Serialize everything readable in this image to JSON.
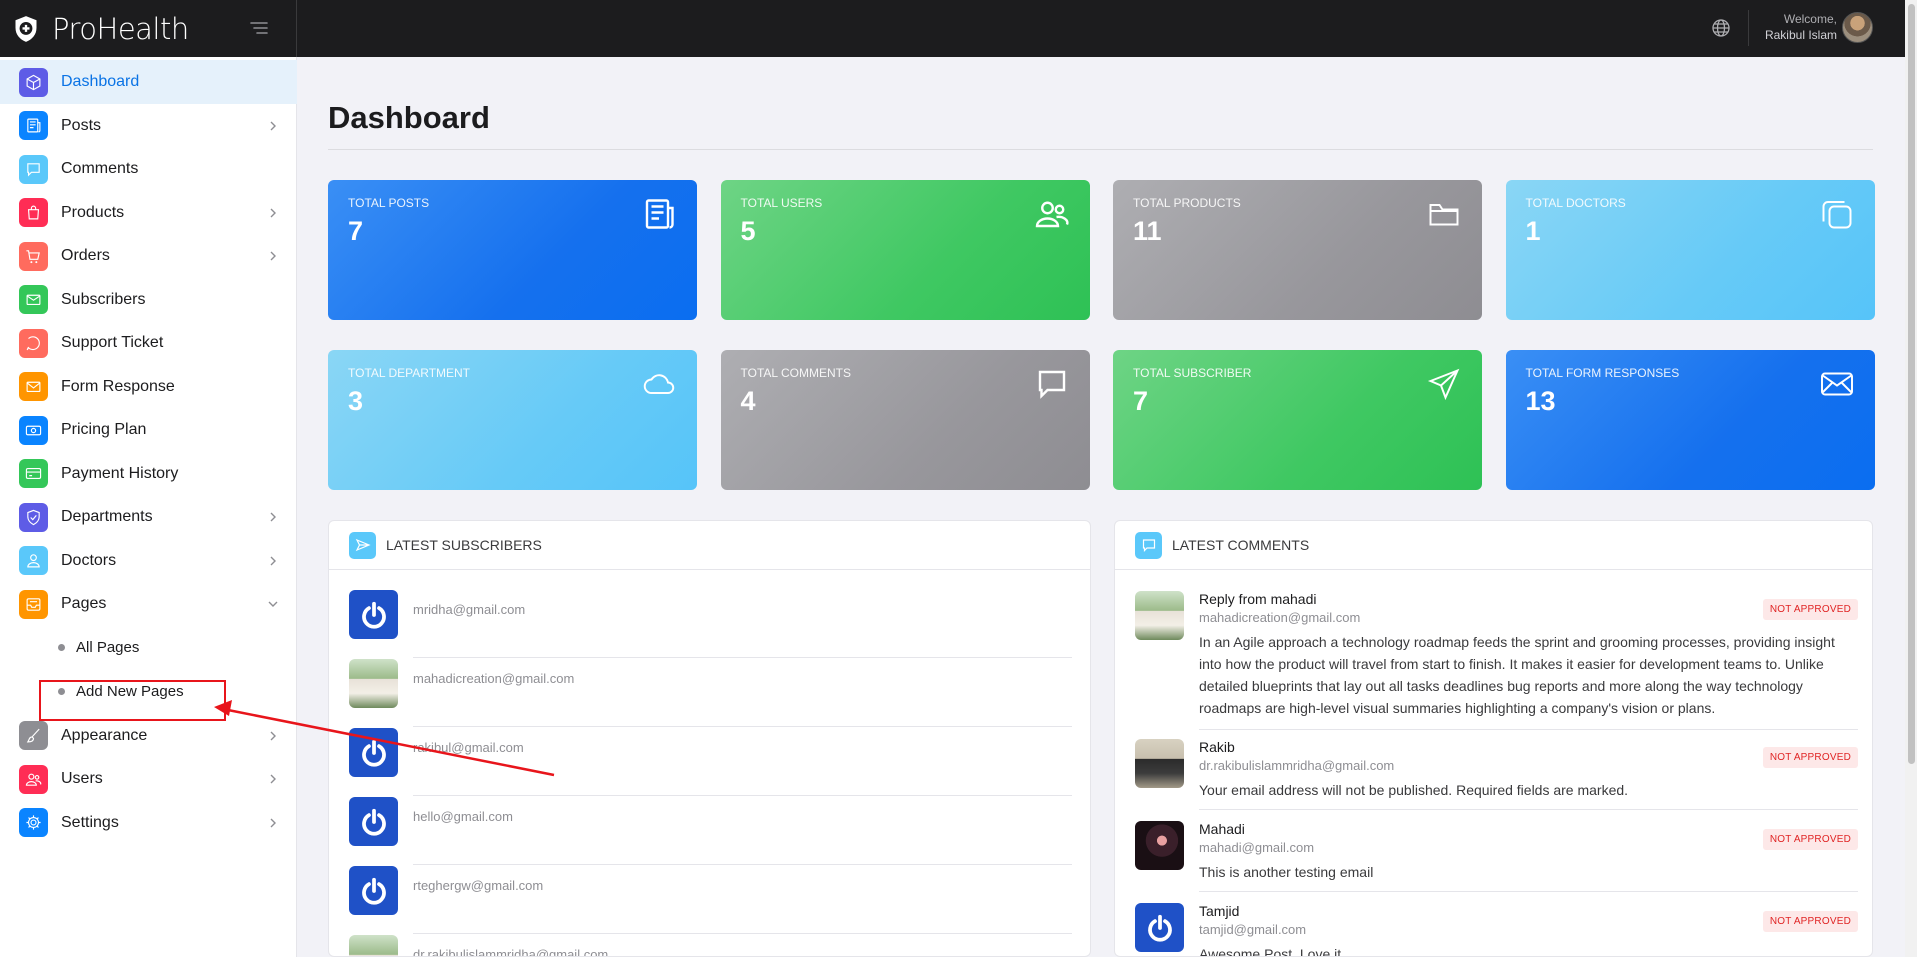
{
  "brand": {
    "name": "ProHealth"
  },
  "topbar": {
    "welcome": "Welcome,",
    "user_name": "Rakibul Islam"
  },
  "sidebar": {
    "items": [
      {
        "label": "Dashboard",
        "icon": "cube-icon",
        "color": "#5e5ce6",
        "active": true,
        "chevron": false
      },
      {
        "label": "Posts",
        "icon": "newspaper-icon",
        "color": "#0a84ff",
        "chevron": true
      },
      {
        "label": "Comments",
        "icon": "chat-bubble-icon",
        "color": "#5ac8fa",
        "chevron": false
      },
      {
        "label": "Products",
        "icon": "shopping-bag-icon",
        "color": "#ff2d55",
        "chevron": true
      },
      {
        "label": "Orders",
        "icon": "cart-icon",
        "color": "#ff6b5e",
        "chevron": true
      },
      {
        "label": "Subscribers",
        "icon": "envelope-icon",
        "color": "#34c759",
        "chevron": false
      },
      {
        "label": "Support Ticket",
        "icon": "lifebuoy-icon",
        "color": "#ff6b5e",
        "chevron": false
      },
      {
        "label": "Form Response",
        "icon": "mail-icon",
        "color": "#ff9500",
        "chevron": false
      },
      {
        "label": "Pricing Plan",
        "icon": "money-icon",
        "color": "#0a84ff",
        "chevron": false
      },
      {
        "label": "Payment History",
        "icon": "credit-card-icon",
        "color": "#34c759",
        "chevron": false
      },
      {
        "label": "Departments",
        "icon": "shield-icon",
        "color": "#5e5ce6",
        "chevron": true
      },
      {
        "label": "Doctors",
        "icon": "user-icon",
        "color": "#5ac8fa",
        "chevron": true
      },
      {
        "label": "Pages",
        "icon": "inbox-icon",
        "color": "#ff9500",
        "chevron": true,
        "expanded": true
      },
      {
        "label": "Appearance",
        "icon": "brush-icon",
        "color": "#8e8e93",
        "chevron": true
      },
      {
        "label": "Users",
        "icon": "users-icon",
        "color": "#ff2d55",
        "chevron": true
      },
      {
        "label": "Settings",
        "icon": "gear-icon",
        "color": "#0a84ff",
        "chevron": true
      }
    ],
    "pages_sub": [
      {
        "label": "All Pages"
      },
      {
        "label": "Add New Pages"
      }
    ]
  },
  "main": {
    "title": "Dashboard"
  },
  "stats": [
    {
      "label": "TOTAL POSTS",
      "value": "7",
      "icon": "newspaper-icon",
      "gradient": "blue"
    },
    {
      "label": "TOTAL USERS",
      "value": "5",
      "icon": "users-icon",
      "gradient": "green"
    },
    {
      "label": "TOTAL PRODUCTS",
      "value": "11",
      "icon": "folder-icon",
      "gradient": "gray"
    },
    {
      "label": "TOTAL DOCTORS",
      "value": "1",
      "icon": "copy-icon",
      "gradient": "sky"
    },
    {
      "label": "TOTAL DEPARTMENT",
      "value": "3",
      "icon": "cloud-icon",
      "gradient": "sky"
    },
    {
      "label": "TOTAL COMMENTS",
      "value": "4",
      "icon": "chat-bubble-icon",
      "gradient": "gray"
    },
    {
      "label": "TOTAL SUBSCRIBER",
      "value": "7",
      "icon": "paper-plane-icon",
      "gradient": "green"
    },
    {
      "label": "TOTAL FORM RESPONSES",
      "value": "13",
      "icon": "envelope-open-icon",
      "gradient": "blue"
    }
  ],
  "subscribers": {
    "title": "LATEST SUBSCRIBERS",
    "items": [
      {
        "email": "mridha@gmail.com",
        "avatar": "power"
      },
      {
        "email": "mahadicreation@gmail.com",
        "avatar": "photo"
      },
      {
        "email": "rakibul@gmail.com",
        "avatar": "power"
      },
      {
        "email": "hello@gmail.com",
        "avatar": "power"
      },
      {
        "email": "rteghergw@gmail.com",
        "avatar": "power"
      },
      {
        "email": "dr.rakibulislammridha@gmail.com",
        "avatar": "photo"
      }
    ]
  },
  "comments": {
    "title": "LATEST COMMENTS",
    "items": [
      {
        "name": "Reply from mahadi",
        "email": "mahadicreation@gmail.com",
        "status": "NOT APPROVED",
        "text": "In an Agile approach a technology roadmap feeds the sprint and grooming processes, providing insight into how the product will travel from start to finish. It makes it easier for development teams to. Unlike detailed blueprints that lay out all tasks deadlines bug reports and more along the way technology roadmaps are high-level visual summaries highlighting a company's vision or plans."
      },
      {
        "name": "Rakib",
        "email": "dr.rakibulislammridha@gmail.com",
        "status": "NOT APPROVED",
        "text": "Your email address will not be published. Required fields are marked."
      },
      {
        "name": "Mahadi",
        "email": "mahadi@gmail.com",
        "status": "NOT APPROVED",
        "text": "This is another testing email"
      },
      {
        "name": "Tamjid",
        "email": "tamjid@gmail.com",
        "status": "NOT APPROVED",
        "text": "Awesome Post. Love it"
      }
    ]
  }
}
